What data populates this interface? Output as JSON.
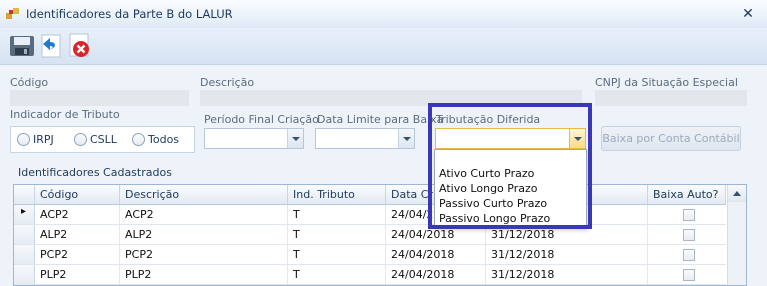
{
  "window": {
    "title": "Identificadores da Parte B do LALUR",
    "close_glyph": "✕"
  },
  "toolbar": {
    "icons": [
      "save-icon",
      "undo-icon",
      "delete-icon"
    ]
  },
  "labels": {
    "codigo": "Código",
    "descricao": "Descrição",
    "cnpj": "CNPJ da Situação Especial",
    "indicador": "Indicador de Tributo",
    "periodo": "Período Final Criação",
    "data_limite": "Data Limite para Baixa",
    "tributacao": "Tributação Diferida"
  },
  "radios": [
    {
      "label": "IRPJ"
    },
    {
      "label": "CSLL"
    },
    {
      "label": "Todos"
    }
  ],
  "baixa_button": "Baixa por Conta Contábil",
  "group_title": "Identificadores Cadastrados",
  "grid": {
    "columns": [
      "Código",
      "Descrição",
      "Ind. Tributo",
      "Data Cria",
      "",
      "Baixa Auto?"
    ],
    "rows": [
      {
        "marker": "▸",
        "codigo": "ACP2",
        "descricao": "ACP2",
        "ind": "T",
        "data": "24/04/2018",
        "limite": ""
      },
      {
        "marker": "",
        "codigo": "ALP2",
        "descricao": "ALP2",
        "ind": "T",
        "data": "24/04/2018",
        "limite": "31/12/2018"
      },
      {
        "marker": "",
        "codigo": "PCP2",
        "descricao": "PCP2",
        "ind": "T",
        "data": "24/04/2018",
        "limite": "31/12/2018"
      },
      {
        "marker": "",
        "codigo": "PLP2",
        "descricao": "PLP2",
        "ind": "T",
        "data": "24/04/2018",
        "limite": "31/12/2018"
      }
    ]
  },
  "dropdown": {
    "items": [
      "Ativo Curto Prazo",
      "Ativo Longo Prazo",
      "Passivo Curto Prazo",
      "Passivo Longo Prazo"
    ]
  },
  "colors": {
    "highlight": "#3b38b7",
    "combo_active": "#e6b94a"
  }
}
